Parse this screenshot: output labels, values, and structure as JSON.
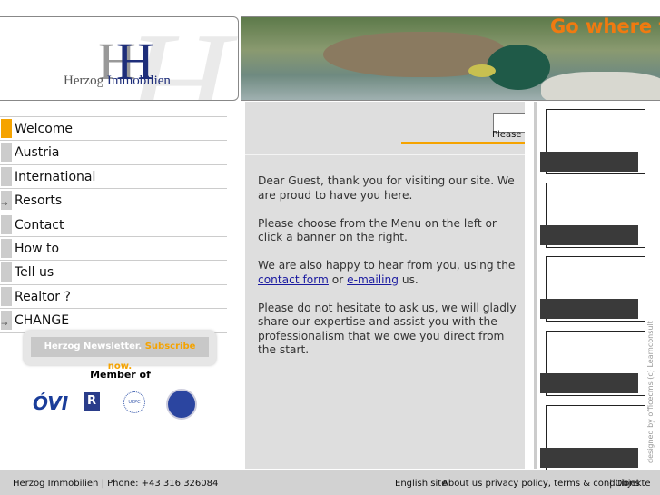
{
  "brand": {
    "name_part1": "Herzog",
    "name_part2": "Immobilien",
    "initial": "H"
  },
  "banner": {
    "slogan": "Go where t"
  },
  "nav": [
    {
      "label": "Welcome",
      "active": true
    },
    {
      "label": "Austria"
    },
    {
      "label": "International"
    },
    {
      "label": "Resorts",
      "arrow": true
    },
    {
      "label": "Contact"
    },
    {
      "label": "How to"
    },
    {
      "label": "Tell us"
    },
    {
      "label": "Realtor ?"
    },
    {
      "label": "CHANGE",
      "arrow": true
    }
  ],
  "newsletter": {
    "text": "Herzog Newsletter.",
    "cta": "Subscribe now."
  },
  "member": {
    "title": "Member of",
    "logos": [
      "ÓVI",
      "R",
      "UEPC",
      "CEI"
    ]
  },
  "search": {
    "hint": "Please e"
  },
  "content": {
    "p1": "Dear Guest, thank you for visiting our site. We are proud to have you here.",
    "p2": "Please choose from the Menu on the left or click a banner on the right.",
    "p3_pre": "We are also happy to hear from you, using the ",
    "p3_link1": "contact form",
    "p3_mid": " or ",
    "p3_link2": "e-mailing",
    "p3_post": " us.",
    "p4": "Please do not hesitate to ask us, we will gladly share our expertise and assist you with the professionalism that we owe you direct from the start."
  },
  "credit": "designed by officecms (c) Learnconsult",
  "footer": {
    "left": "Herzog Immobilien | Phone: +43 316 326084",
    "english": "English site",
    "about": "About us privacy policy, terms & conditions",
    "objekte": "| Objekte"
  },
  "colors": {
    "accent": "#f5a300",
    "brand_blue": "#1e2e7a",
    "slogan": "#f07a10"
  }
}
